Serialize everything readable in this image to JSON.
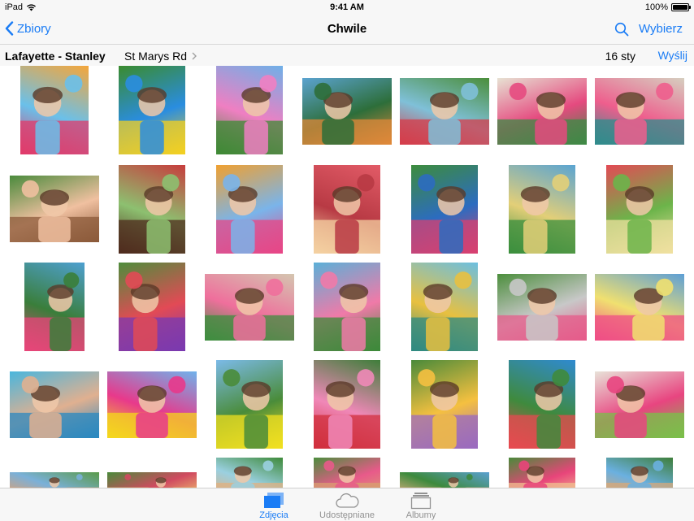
{
  "status": {
    "device": "iPad",
    "time": "9:41 AM",
    "battery": "100%",
    "battery_level": 1.0
  },
  "nav": {
    "back_label": "Zbiory",
    "title": "Chwile",
    "select_label": "Wybierz"
  },
  "moment": {
    "location_main": "Lafayette - Stanley",
    "location_sub": "St Marys Rd",
    "date": "16 sty",
    "share_label": "Wyślij"
  },
  "tabs": [
    {
      "label": "Zdjęcia",
      "icon": "photos-icon",
      "active": true
    },
    {
      "label": "Udostępniane",
      "icon": "cloud-icon",
      "active": false
    },
    {
      "label": "Albumy",
      "icon": "albums-icon",
      "active": false
    }
  ],
  "colors": {
    "accent": "#1a7cf5",
    "bar_bg": "#f7f7f7",
    "tab_inactive": "#929292"
  },
  "photos": [
    {
      "subject": "girl-with-balloons",
      "colors": [
        "#f5a63a",
        "#e23a6a",
        "#6ac0ea"
      ]
    },
    {
      "subject": "balloons-on-lawn",
      "colors": [
        "#3a8b2e",
        "#f4d020",
        "#2a8de0"
      ]
    },
    {
      "subject": "girl-with-balloons-trees",
      "colors": [
        "#6fb0e8",
        "#3e8a34",
        "#ef7fc2"
      ]
    },
    {
      "subject": "kids-by-pool",
      "colors": [
        "#5ba3d0",
        "#e0883a",
        "#2d6e3a"
      ]
    },
    {
      "subject": "boy-and-girl-lawn",
      "colors": [
        "#4b8e3a",
        "#d53c4a",
        "#7fc0d8"
      ]
    },
    {
      "subject": "girls-with-cupcakes",
      "colors": [
        "#e7e2d3",
        "#3d8a45",
        "#e54a7f"
      ]
    },
    {
      "subject": "mother-and-daughters",
      "colors": [
        "#d6cfc0",
        "#2f8c8c",
        "#ee5e8d"
      ]
    },
    {
      "subject": "mother-hugging-girl",
      "colors": [
        "#4a8a3c",
        "#8b5a3a",
        "#f0c0a0"
      ]
    },
    {
      "subject": "chocolate-cupcake",
      "colors": [
        "#c73d3d",
        "#4f2b1e",
        "#8dc070"
      ]
    },
    {
      "subject": "girl-balloons-smiling",
      "colors": [
        "#f0a030",
        "#e84585",
        "#7ab4ea"
      ]
    },
    {
      "subject": "cupcakes-on-table",
      "colors": [
        "#e25b67",
        "#f4d2a2",
        "#b83a44"
      ]
    },
    {
      "subject": "girl-party-hat",
      "colors": [
        "#3d8c3c",
        "#d84070",
        "#2c6cc0"
      ]
    },
    {
      "subject": "girl-eating-cupcake",
      "colors": [
        "#5aa4d2",
        "#3b8f3e",
        "#e3cf78"
      ]
    },
    {
      "subject": "chips-bowl",
      "colors": [
        "#e34a55",
        "#f0e0a0",
        "#6cb44a"
      ]
    },
    {
      "subject": "girl-with-ice-cream",
      "colors": [
        "#4ea0d0",
        "#e8457a",
        "#3a7e3a"
      ]
    },
    {
      "subject": "girl-purple-hat",
      "colors": [
        "#4f8d3c",
        "#7a3ab0",
        "#e24a55"
      ]
    },
    {
      "subject": "mother-blowing-candles",
      "colors": [
        "#d4c6b0",
        "#3d8e3f",
        "#ef6f9c"
      ]
    },
    {
      "subject": "girl-at-cake-table",
      "colors": [
        "#5bb0d8",
        "#3c8a3a",
        "#f07aa8"
      ]
    },
    {
      "subject": "girl-with-bracelet",
      "colors": [
        "#6cbfe0",
        "#2f8a82",
        "#e8c040"
      ]
    },
    {
      "subject": "girl-blowing-candles",
      "colors": [
        "#4c8e3d",
        "#e65b8a",
        "#c8c8c8"
      ]
    },
    {
      "subject": "girl-with-cake",
      "colors": [
        "#5d9fd6",
        "#ef4d86",
        "#f0e070"
      ]
    },
    {
      "subject": "boy-swimming-pool",
      "colors": [
        "#4ab6dd",
        "#2a88c0",
        "#e0b090"
      ]
    },
    {
      "subject": "balloons-sky",
      "colors": [
        "#6fb3ec",
        "#f4d81c",
        "#e8398b"
      ]
    },
    {
      "subject": "balloons-garden",
      "colors": [
        "#7bbae8",
        "#f2e020",
        "#4a8c3a"
      ]
    },
    {
      "subject": "kids-with-balloons",
      "colors": [
        "#3e7e3a",
        "#d02f3c",
        "#f088b8"
      ]
    },
    {
      "subject": "girl-waving",
      "colors": [
        "#4a8a3a",
        "#9a6ac0",
        "#f5c040"
      ]
    },
    {
      "subject": "kids-under-umbrella",
      "colors": [
        "#2f8ad0",
        "#e84a50",
        "#3f8a3d"
      ]
    },
    {
      "subject": "colorful-decorations",
      "colors": [
        "#e8e2d8",
        "#79c04a",
        "#e84580"
      ]
    },
    {
      "subject": "bottom-row-1",
      "colors": [
        "#5a9a4a",
        "#e0a070",
        "#7ab0d8"
      ]
    },
    {
      "subject": "bottom-row-2",
      "colors": [
        "#4a8a3a",
        "#f0c070",
        "#d04a60"
      ]
    },
    {
      "subject": "bottom-row-3",
      "colors": [
        "#3e8a3a",
        "#e0b080",
        "#9ad0e0"
      ]
    },
    {
      "subject": "bottom-row-4",
      "colors": [
        "#4c8e3d",
        "#d8a070",
        "#e85a8a"
      ]
    },
    {
      "subject": "bottom-row-5",
      "colors": [
        "#5aa0d0",
        "#e0b080",
        "#3d8a3d"
      ]
    },
    {
      "subject": "bottom-row-6",
      "colors": [
        "#4a8a3a",
        "#f0c090",
        "#e8457a"
      ]
    },
    {
      "subject": "bottom-row-7",
      "colors": [
        "#3e7e3a",
        "#d8a878",
        "#6ab0e0"
      ]
    }
  ]
}
